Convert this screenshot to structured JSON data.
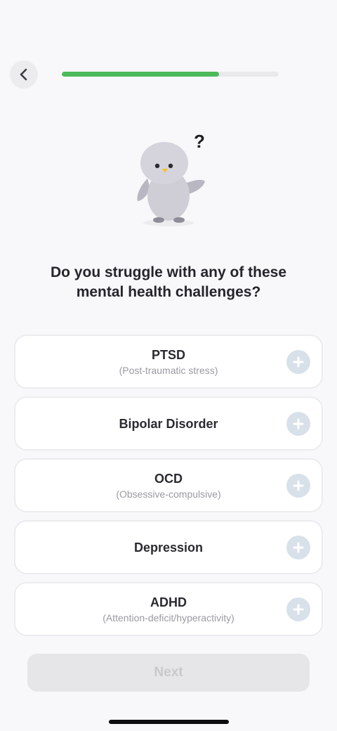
{
  "header": {
    "back_icon": "chevron-left-icon",
    "progress_fraction": 0.725,
    "progress_color": "#4cba5b"
  },
  "mascot": {
    "question_mark": "?"
  },
  "question": {
    "line1": "Do you struggle with any of these",
    "line2": "mental health challenges?"
  },
  "options": [
    {
      "title": "PTSD",
      "subtitle": "(Post-traumatic stress)"
    },
    {
      "title": "Bipolar Disorder",
      "subtitle": ""
    },
    {
      "title": "OCD",
      "subtitle": "(Obsessive-compulsive)"
    },
    {
      "title": "Depression",
      "subtitle": ""
    },
    {
      "title": "ADHD",
      "subtitle": "(Attention-deficit/hyperactivity)"
    }
  ],
  "add_icon": "plus-circle-icon",
  "next_button": {
    "label": "Next",
    "disabled": true
  }
}
